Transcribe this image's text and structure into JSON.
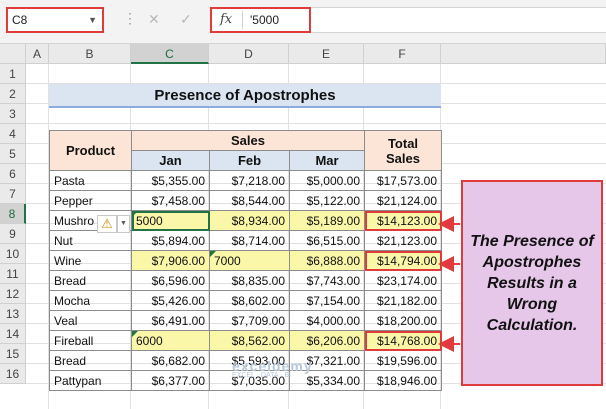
{
  "formula_bar": {
    "name_box": "C8",
    "fx_label": "fx",
    "formula_value": "'5000"
  },
  "columns": [
    "A",
    "B",
    "C",
    "D",
    "E",
    "F"
  ],
  "rows": [
    "1",
    "2",
    "3",
    "4",
    "5",
    "6",
    "7",
    "8",
    "9",
    "10",
    "11",
    "12",
    "13",
    "14",
    "15",
    "16"
  ],
  "sheet": {
    "title": "Presence of Apostrophes",
    "headers": {
      "product": "Product",
      "sales": "Sales",
      "total_sales_line1": "Total",
      "total_sales_line2": "Sales",
      "months": [
        "Jan",
        "Feb",
        "Mar"
      ]
    },
    "data_rows": [
      {
        "product": "Pasta",
        "jan": "$5,355.00",
        "feb": "$7,218.00",
        "mar": "$5,000.00",
        "total": "$17,573.00"
      },
      {
        "product": "Pepper",
        "jan": "$7,458.00",
        "feb": "$8,544.00",
        "mar": "$5,122.00",
        "total": "$21,124.00"
      },
      {
        "product": "Mushro",
        "jan": "5000",
        "feb": "$8,934.00",
        "mar": "$5,189.00",
        "total": "$14,123.00"
      },
      {
        "product": "Nut",
        "jan": "$5,894.00",
        "feb": "$8,714.00",
        "mar": "$6,515.00",
        "total": "$21,123.00"
      },
      {
        "product": "Wine",
        "jan": "$7,906.00",
        "feb": "7000",
        "mar": "$6,888.00",
        "total": "$14,794.00"
      },
      {
        "product": "Bread",
        "jan": "$6,596.00",
        "feb": "$8,835.00",
        "mar": "$7,743.00",
        "total": "$23,174.00"
      },
      {
        "product": "Mocha",
        "jan": "$5,426.00",
        "feb": "$8,602.00",
        "mar": "$7,154.00",
        "total": "$21,182.00"
      },
      {
        "product": "Veal",
        "jan": "$6,491.00",
        "feb": "$7,709.00",
        "mar": "$4,000.00",
        "total": "$18,200.00"
      },
      {
        "product": "Fireball",
        "jan": "6000",
        "feb": "$8,562.00",
        "mar": "$6,206.00",
        "total": "$14,768.00"
      },
      {
        "product": "Bread",
        "jan": "$6,682.00",
        "feb": "$5,593.00",
        "mar": "$7,321.00",
        "total": "$19,596.00"
      },
      {
        "product": "Pattypan",
        "jan": "$6,377.00",
        "feb": "$7,035.00",
        "mar": "$5,334.00",
        "total": "$18,946.00"
      }
    ]
  },
  "callout": {
    "text": "The Presence of Apostrophes Results in a Wrong Calculation."
  },
  "warning_icon": "warning-triangle-icon",
  "watermark": {
    "brand": "exceldemy",
    "tagline": "EXCEL · DATA · BI"
  },
  "colors": {
    "highlight": "#fbf7a8",
    "header_fill": "#fce4d6",
    "subheader_fill": "#dbe5f1",
    "callout_fill": "#e6c7e9",
    "red_border": "#e03b3b",
    "excel_green": "#217346"
  }
}
